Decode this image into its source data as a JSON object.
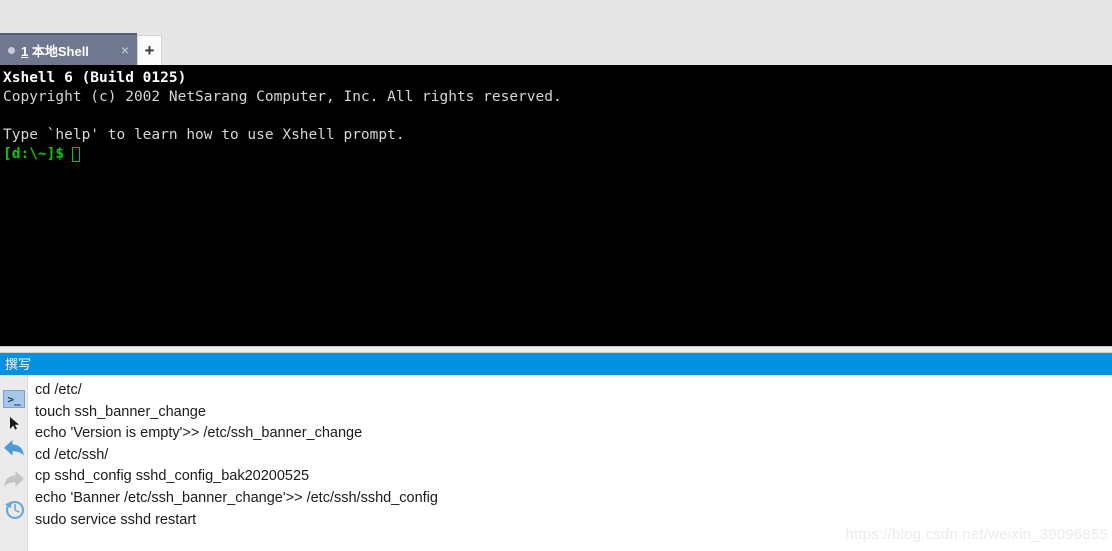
{
  "window": {
    "app_title": "Xshell 6"
  },
  "tab_bar": {
    "tabs": [
      {
        "label": "1 本地Shell",
        "number": "1",
        "name": "本地Shell",
        "close_label": "×",
        "active": true,
        "status_dot": "session-status-dot"
      }
    ],
    "new_tab_label": "+"
  },
  "terminal": {
    "lines": [
      {
        "text": "Xshell 6 (Build 0125)",
        "style": "bold"
      },
      {
        "text": "Copyright (c) 2002 NetSarang Computer, Inc. All rights reserved.",
        "style": "normal"
      },
      {
        "text": "",
        "style": "blank"
      },
      {
        "text": "Type `help' to learn how to use Xshell prompt.",
        "style": "normal"
      }
    ],
    "prompt": "[d:\\~]$",
    "cursor": "block-cursor",
    "background_color": "#000000",
    "text_color": "#d6d6d6",
    "prompt_color": "#00cc00"
  },
  "compose_panel": {
    "header_title": "撰写",
    "header_color": "#0092e0",
    "icons": [
      {
        "name": "terminal-prompt-icon",
        "glyph": ">_",
        "state": "selected"
      },
      {
        "name": "cursor-arrow-icon",
        "glyph": "▸",
        "state": "normal"
      },
      {
        "name": "back-arrow-icon",
        "glyph": "⬅",
        "state": "enabled"
      },
      {
        "name": "forward-arrow-icon",
        "glyph": "➡",
        "state": "disabled"
      },
      {
        "name": "history-undo-icon",
        "glyph": "↺",
        "state": "enabled"
      }
    ],
    "commands": [
      "cd /etc/",
      "touch ssh_banner_change",
      "echo 'Version is empty'>> /etc/ssh_banner_change",
      "cd /etc/ssh/",
      "cp sshd_config sshd_config_bak20200525",
      "echo 'Banner /etc/ssh_banner_change'>> /etc/ssh/sshd_config",
      "sudo service sshd restart"
    ]
  },
  "watermark": {
    "text": "https://blog.csdn.net/weixin_39096855"
  }
}
